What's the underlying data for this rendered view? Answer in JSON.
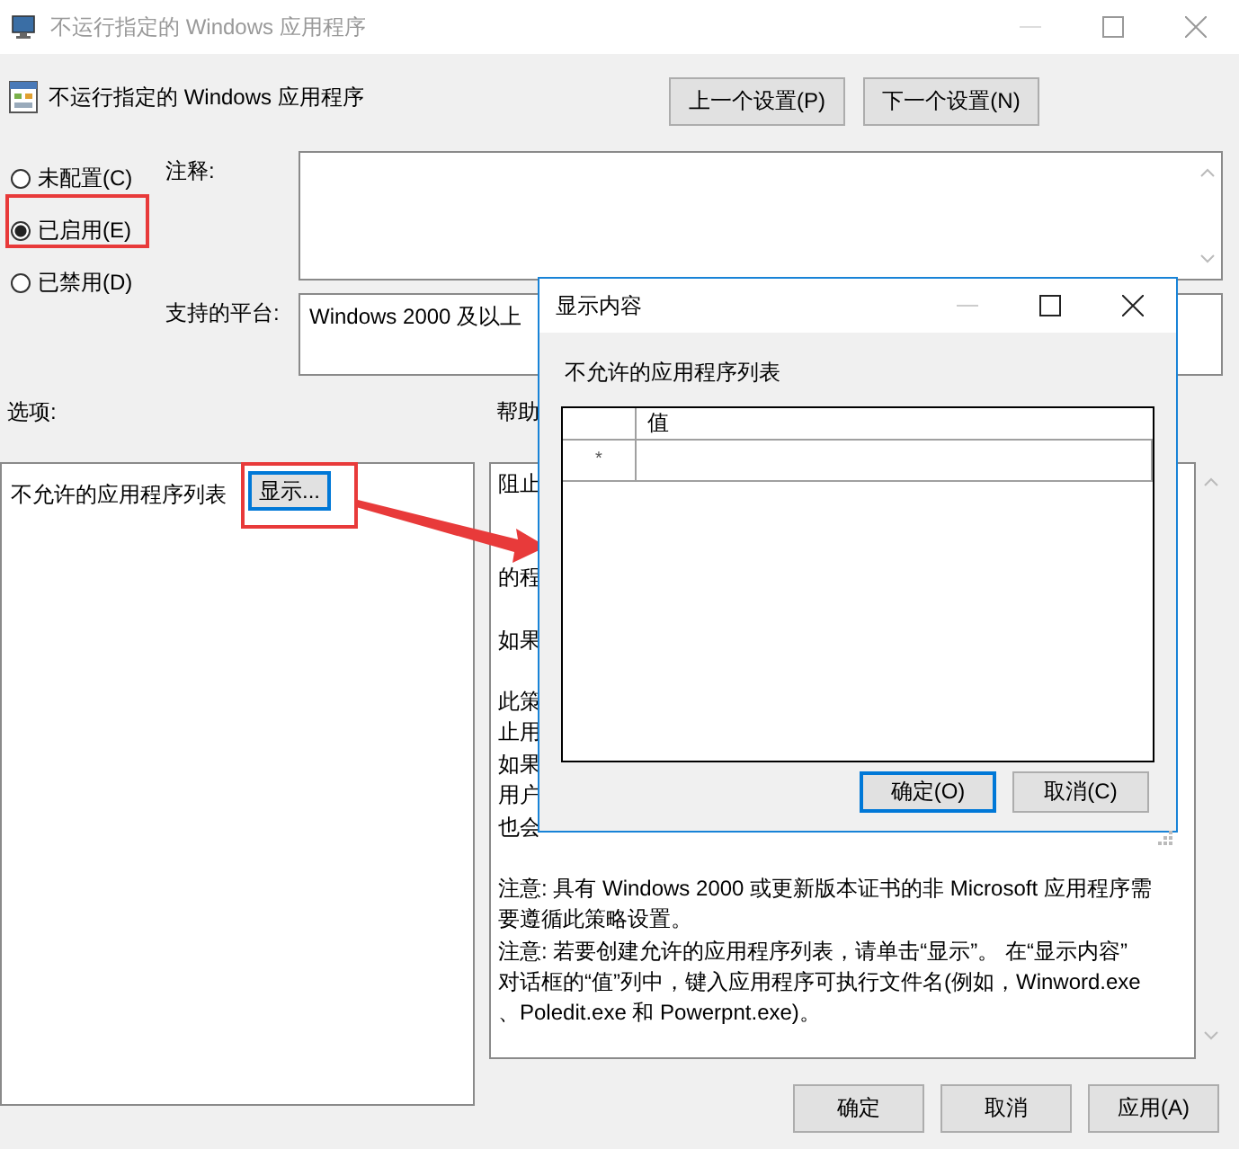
{
  "window": {
    "title": "不运行指定的 Windows 应用程序"
  },
  "header": {
    "title": "不运行指定的 Windows 应用程序",
    "nav_buttons": [
      "上一个设置(P)",
      "下一个设置(N)"
    ]
  },
  "state_options": [
    {
      "label": "未配置(C)",
      "selected": false
    },
    {
      "label": "已启用(E)",
      "selected": true
    },
    {
      "label": "已禁用(D)",
      "selected": false
    }
  ],
  "comment": {
    "label": "注释:"
  },
  "platform": {
    "label": "支持的平台:",
    "value": "Windows 2000 及以上"
  },
  "options_label": "选项:",
  "help_label": "帮助",
  "options": {
    "label": "不允许的应用程序列表",
    "button": "显示..."
  },
  "help_paragraphs": [
    [
      {
        "left": "阻止"
      }
    ],
    [
      {
        "left": "的程"
      }
    ],
    [
      {
        "left": "如果"
      }
    ],
    [
      {
        "left": "此策"
      },
      {
        "left": "止用"
      },
      {
        "left": "如果"
      },
      {
        "left": "用户"
      },
      {
        "left": "也会"
      }
    ],
    [
      {
        "left": "注意: 具有 Windows 2000 或更新版本证书的非 Microsoft 应用程序需"
      },
      {
        "left": "要遵循此策略设置。"
      },
      {
        "left": "注意: 若要创建允许的应用程序列表，请单击“显示”。 在“显示内容”"
      },
      {
        "left": "对话框的“值”列中，键入应用程序可执行文件名(例如，Winword.exe"
      },
      {
        "left": "、Poledit.exe 和 Powerpnt.exe)。"
      }
    ]
  ],
  "buttons": [
    "确定",
    "取消",
    "应用(A)"
  ],
  "dialog": {
    "title": "显示内容",
    "label": "不允许的应用程序列表",
    "columns": [
      "值"
    ],
    "rows": [
      {
        "marker": "*"
      }
    ],
    "buttons": [
      {
        "label": "确定(O)",
        "selected": true
      },
      {
        "label": "取消(C)",
        "selected": false
      }
    ]
  }
}
